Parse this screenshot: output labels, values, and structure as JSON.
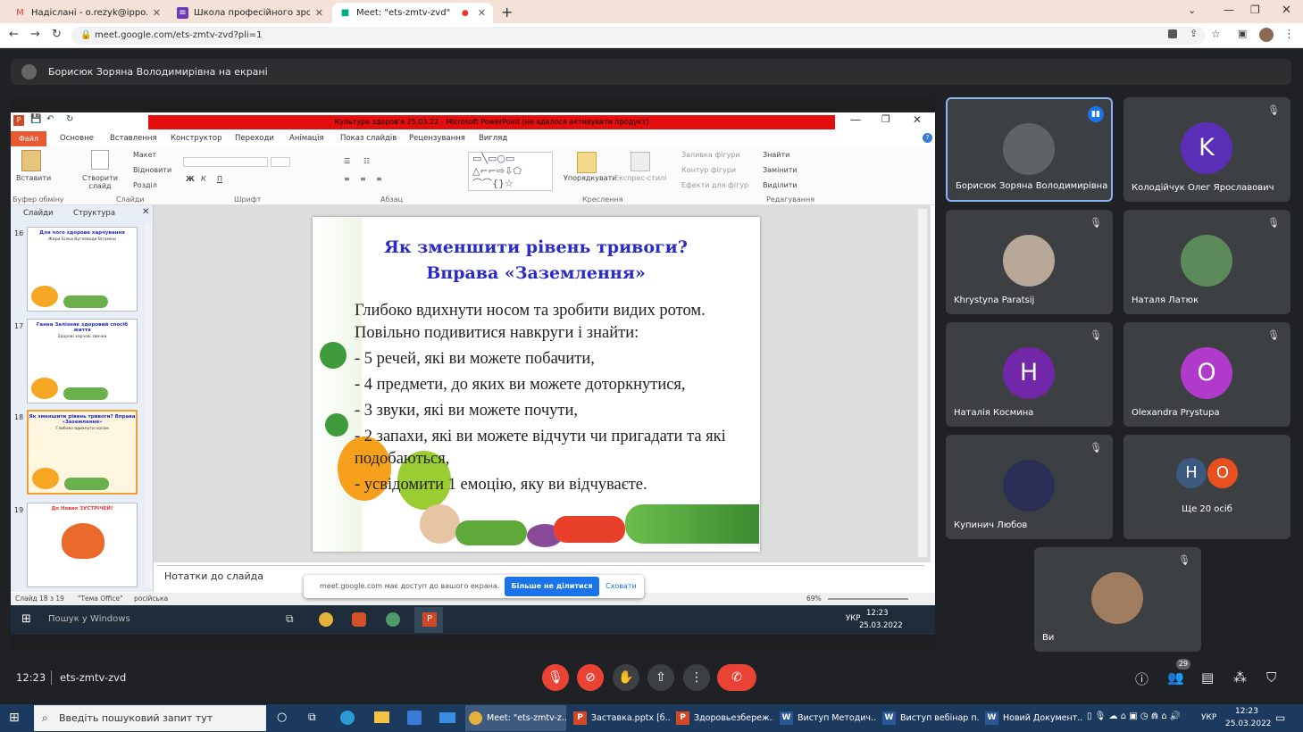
{
  "browser": {
    "tabs": [
      {
        "title": "Надіслані - o.rezyk@ippo.edu.t",
        "icon": "gmail-icon"
      },
      {
        "title": "Школа професійного зростан",
        "icon": "forms-icon"
      },
      {
        "title": "Meet: \"ets-zmtv-zvd\"",
        "icon": "meet-icon"
      }
    ],
    "url": "meet.google.com/ets-zmtv-zvd?pli=1"
  },
  "presenting_banner": "Борисюк Зоряна Володимирівна на екрані",
  "ppt": {
    "window_title": "Культура здоров'я 25.03.22 - Microsoft PowerPoint (не вдалося активувати продукт)",
    "file_tab": "Файл",
    "menu": [
      "Основне",
      "Вставлення",
      "Конструктор",
      "Переходи",
      "Анімація",
      "Показ слайдів",
      "Рецензування",
      "Вигляд"
    ],
    "ribbon": {
      "paste": "Вставити",
      "create_slide": "Створити слайд",
      "layout": "Макет",
      "reset": "Відновити",
      "section": "Розділ",
      "arrange": "Упорядкувати",
      "quick_styles": "Експрес-стилі",
      "fill": "Заливка фігури",
      "outline": "Контур фігури",
      "effects": "Ефекти для фігур",
      "find": "Знайти",
      "replace": "Замінити",
      "select": "Виділити",
      "groups": [
        "Буфер обміну",
        "Слайди",
        "Шрифт",
        "Абзац",
        "Креслення",
        "Редагування"
      ]
    },
    "pane_tabs": [
      "Слайди",
      "Структура"
    ],
    "thumbs": [
      {
        "num": "16",
        "title": "Для чого здорове харчування",
        "body": "Жири Білки Вуглеводи Вітаміни"
      },
      {
        "num": "17",
        "title": "Ганна Залізняк здоровий спосіб життя",
        "body": "Здорові харчові звички"
      },
      {
        "num": "18",
        "title": "Як зменшити рівень тривоги? Вправа «Заземлення»",
        "body": "Глибоко вдихнути носом"
      },
      {
        "num": "19",
        "title": "До Нових ЗУСТРІЧЕЙ!",
        "body": ""
      }
    ],
    "slide": {
      "title_line1": "Як зменшити рівень тривоги?",
      "title_line2": "Вправа «Заземлення»",
      "lines": [
        "Глибоко вдихнути носом та зробити видих ротом. Повільно подивитися навкруги і знайти:",
        "- 5 речей, які ви можете побачити,",
        "- 4 предмети, до яких ви можете доторкнутися,",
        "- 3 звуки, які ви можете почути,",
        "- 2 запахи, які ви можете відчути чи пригадати та які подобаються,",
        "- усвідомити 1 емоцію, яку ви відчуваєте."
      ]
    },
    "notes_placeholder": "Нотатки до слайда",
    "status_slide": "Слайд 18 з 19",
    "status_theme": "\"Тема Office\"",
    "status_lang": "російська",
    "zoom": "69%"
  },
  "share_popup": {
    "text": "meet.google.com має доступ до вашого екрана.",
    "stop": "Більше не ділитися",
    "hide": "Сховати"
  },
  "inner_taskbar": {
    "search": "Пошук у Windows",
    "time": "12:23",
    "date": "25.03.2022",
    "lang": "УКР"
  },
  "participants": [
    {
      "name": "Борисюк Зоряна Володимирівна",
      "initial": "",
      "color": "#5f6368",
      "speaking": true
    },
    {
      "name": "Колодійчук Олег Ярославович",
      "initial": "K",
      "color": "#5b2eb8",
      "speaking": false
    },
    {
      "name": "Khrystyna Paratsij",
      "initial": "",
      "color": "#b8a89a",
      "speaking": false
    },
    {
      "name": "Наталя Латюк",
      "initial": "",
      "color": "#5c8a5a",
      "speaking": false
    },
    {
      "name": "Наталія Космина",
      "initial": "Н",
      "color": "#7227a8",
      "speaking": false
    },
    {
      "name": "Olexandra Prystupa",
      "initial": "O",
      "color": "#b03aca",
      "speaking": false
    },
    {
      "name": "Купинич Любов",
      "initial": "",
      "color": "#2b2e55",
      "speaking": false
    },
    {
      "name": "Ще 20 осіб",
      "initial": "",
      "color": "",
      "speaking": false
    },
    {
      "name": "Ви",
      "initial": "",
      "color": "#a07c60",
      "speaking": false
    }
  ],
  "more_avatars": [
    "Н",
    "О"
  ],
  "meeting": {
    "time": "12:23",
    "code": "ets-zmtv-zvd",
    "people_count": "29"
  },
  "win_taskbar": {
    "search": "Введіть пошуковий запит тут",
    "apps": [
      "Meet: \"ets-zmtv-z...",
      "Заставка.pptx [б...",
      "Здоровьезбереж...",
      "Виступ Методич...",
      "Виступ вебінар п...",
      "Новий Документ..."
    ],
    "lang": "УКР",
    "time": "12:23",
    "date": "25.03.2022"
  },
  "colors": {
    "meet_bg": "#202124",
    "tile_bg": "#3c4043",
    "end_call": "#ea4335",
    "accent": "#1a73e8",
    "ppt_red_bar": "#e40e0e"
  }
}
